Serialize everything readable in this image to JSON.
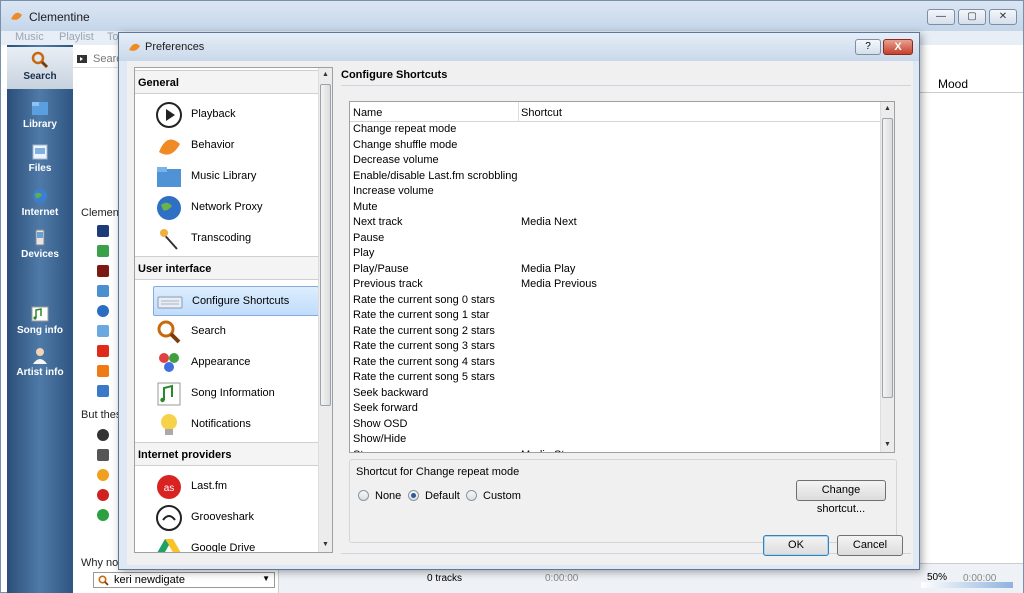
{
  "main_window": {
    "title": "Clementine",
    "menu": [
      "Music",
      "Playlist",
      "To"
    ],
    "win_buttons": [
      "—",
      "▢",
      "✕"
    ]
  },
  "sidebar": {
    "items": [
      {
        "label": "Search",
        "icon": "search-icon",
        "active": true
      },
      {
        "label": "Library",
        "icon": "library-icon"
      },
      {
        "label": "Files",
        "icon": "files-icon"
      },
      {
        "label": "Internet",
        "icon": "internet-icon"
      },
      {
        "label": "Devices",
        "icon": "devices-icon"
      },
      {
        "label": "Song info",
        "icon": "song-info-icon"
      },
      {
        "label": "Artist info",
        "icon": "artist-info-icon"
      }
    ]
  },
  "library_panel": {
    "search_placeholder": "Search",
    "text_clementine": "Clement",
    "text_but": "But thes",
    "text_why": "Why not",
    "bottom_search_value": "keri newdigate"
  },
  "playlist": {
    "mood_header": "Mood",
    "volume_text": "50%",
    "volume_level": 0.5,
    "track_count": "0 tracks",
    "time_left": "0:00:00",
    "time_right": "0:00:00"
  },
  "dialog": {
    "title": "Preferences",
    "help_label": "?",
    "close_label": "X",
    "categories": {
      "general_header": "General",
      "general_items": [
        {
          "label": "Playback",
          "icon": "playback-icon"
        },
        {
          "label": "Behavior",
          "icon": "behavior-icon"
        },
        {
          "label": "Music Library",
          "icon": "music-library-icon"
        },
        {
          "label": "Network Proxy",
          "icon": "network-proxy-icon"
        },
        {
          "label": "Transcoding",
          "icon": "transcoding-icon"
        }
      ],
      "ui_header": "User interface",
      "ui_items": [
        {
          "label": "Configure Shortcuts",
          "icon": "keyboard-icon",
          "selected": true
        },
        {
          "label": "Search",
          "icon": "search-icon"
        },
        {
          "label": "Appearance",
          "icon": "appearance-icon"
        },
        {
          "label": "Song Information",
          "icon": "song-information-icon"
        },
        {
          "label": "Notifications",
          "icon": "lightbulb-icon"
        }
      ],
      "providers_header": "Internet providers",
      "provider_items": [
        {
          "label": "Last.fm",
          "icon": "lastfm-icon"
        },
        {
          "label": "Grooveshark",
          "icon": "grooveshark-icon"
        },
        {
          "label": "Google Drive",
          "icon": "google-drive-icon"
        }
      ]
    },
    "page_title": "Configure Shortcuts",
    "table": {
      "columns": [
        "Name",
        "Shortcut"
      ],
      "rows": [
        {
          "name": "Change repeat mode",
          "shortcut": ""
        },
        {
          "name": "Change shuffle mode",
          "shortcut": ""
        },
        {
          "name": "Decrease volume",
          "shortcut": ""
        },
        {
          "name": "Enable/disable Last.fm scrobbling",
          "shortcut": ""
        },
        {
          "name": "Increase volume",
          "shortcut": ""
        },
        {
          "name": "Mute",
          "shortcut": ""
        },
        {
          "name": "Next track",
          "shortcut": "Media Next"
        },
        {
          "name": "Pause",
          "shortcut": ""
        },
        {
          "name": "Play",
          "shortcut": ""
        },
        {
          "name": "Play/Pause",
          "shortcut": "Media Play"
        },
        {
          "name": "Previous track",
          "shortcut": "Media Previous"
        },
        {
          "name": "Rate the current song 0 stars",
          "shortcut": ""
        },
        {
          "name": "Rate the current song 1 star",
          "shortcut": ""
        },
        {
          "name": "Rate the current song 2 stars",
          "shortcut": ""
        },
        {
          "name": "Rate the current song 3 stars",
          "shortcut": ""
        },
        {
          "name": "Rate the current song 4 stars",
          "shortcut": ""
        },
        {
          "name": "Rate the current song 5 stars",
          "shortcut": ""
        },
        {
          "name": "Seek backward",
          "shortcut": ""
        },
        {
          "name": "Seek forward",
          "shortcut": ""
        },
        {
          "name": "Show OSD",
          "shortcut": ""
        },
        {
          "name": "Show/Hide",
          "shortcut": ""
        },
        {
          "name": "Stop",
          "shortcut": "Media Stop"
        }
      ]
    },
    "shortcut_group": {
      "legend": "Shortcut for Change repeat mode",
      "options": [
        {
          "label": "None",
          "checked": false
        },
        {
          "label": "Default",
          "checked": true
        },
        {
          "label": "Custom",
          "checked": false
        }
      ],
      "change_button": "Change shortcut..."
    },
    "ok_button": "OK",
    "cancel_button": "Cancel"
  }
}
